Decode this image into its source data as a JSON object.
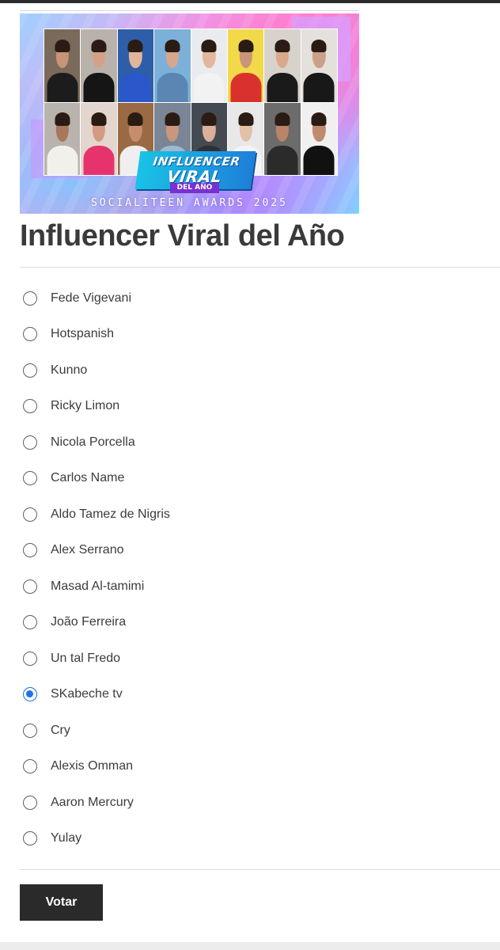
{
  "banner": {
    "badge_line1": "INFLUENCER",
    "badge_line2": "VIRAL",
    "badge_sub": "DEL AÑO",
    "awards_text": "SOCIALITEEN AWARDS 2025",
    "photos": [
      {
        "bg": "#7a6a5c",
        "skin": "#c89377",
        "top": "#1c1c1c"
      },
      {
        "bg": "#b9b2aa",
        "skin": "#d3a286",
        "top": "#151515"
      },
      {
        "bg": "#2f5ea8",
        "skin": "#e1b59c",
        "top": "#2a57c9"
      },
      {
        "bg": "#7db0d9",
        "skin": "#d7a68b",
        "top": "#5b86b4"
      },
      {
        "bg": "#e9ebee",
        "skin": "#e2b79e",
        "top": "#f2f2f2"
      },
      {
        "bg": "#f1d94a",
        "skin": "#c99478",
        "top": "#d9322e"
      },
      {
        "bg": "#d8d2cc",
        "skin": "#dba88c",
        "top": "#1a1a1a"
      },
      {
        "bg": "#e4e0dc",
        "skin": "#caa088",
        "top": "#181818"
      },
      {
        "bg": "#b8b3ad",
        "skin": "#a9775c",
        "top": "#f2f0ea"
      },
      {
        "bg": "#e3d6cf",
        "skin": "#d19c82",
        "top": "#e6336e"
      },
      {
        "bg": "#9a6a44",
        "skin": "#c58d6c",
        "top": "#efefef"
      },
      {
        "bg": "#7a8696",
        "skin": "#c8977c",
        "top": "#9fb9d1"
      },
      {
        "bg": "#444a52",
        "skin": "#dcb09a",
        "top": "#303033"
      },
      {
        "bg": "#e8e8e8",
        "skin": "#e3c0a8",
        "top": "#f4f4f4"
      },
      {
        "bg": "#6c6c6c",
        "skin": "#b98467",
        "top": "#2b2b2b"
      },
      {
        "bg": "#f0f0f0",
        "skin": "#c08a6e",
        "top": "#111111"
      }
    ]
  },
  "poll": {
    "title": "Influencer Viral del Año",
    "selected_index": 11,
    "options": [
      "Fede Vigevani",
      "Hotspanish",
      "Kunno",
      "Ricky Limon",
      "Nicola Porcella",
      "Carlos Name",
      "Aldo Tamez de Nigris",
      "Alex Serrano",
      "Masad Al-tamimi",
      "João Ferreira",
      "Un tal Fredo",
      "SKabeche tv",
      "Cry",
      "Alexis Omman",
      "Aaron Mercury",
      "Yulay"
    ],
    "submit_label": "Votar"
  },
  "colors": {
    "accent": "#1a73e8",
    "button_bg": "#2a2a2a",
    "title_color": "#3a3a3a"
  }
}
